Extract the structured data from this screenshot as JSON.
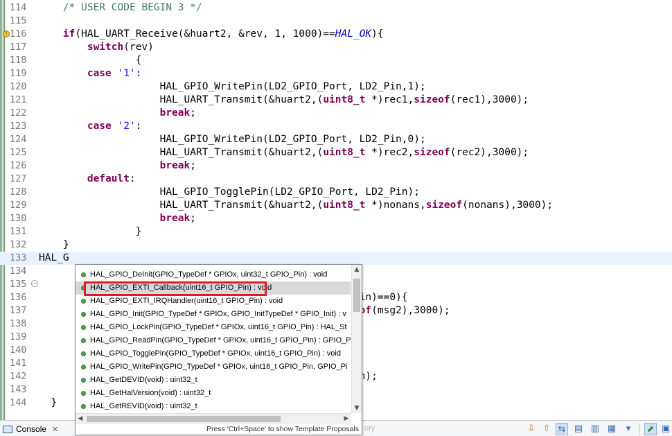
{
  "editor": {
    "lines": [
      {
        "n": "114",
        "segs": [
          {
            "t": "    ",
            "c": ""
          },
          {
            "t": "/* USER CODE BEGIN 3 */",
            "c": "cm"
          }
        ]
      },
      {
        "n": "115",
        "segs": []
      },
      {
        "n": "116",
        "marker": "warning",
        "segs": [
          {
            "t": "    ",
            "c": ""
          },
          {
            "t": "if",
            "c": "kw"
          },
          {
            "t": "(HAL_UART_Receive(&huart2, &rev, 1, 1000)==",
            "c": ""
          },
          {
            "t": "HAL_OK",
            "c": "it"
          },
          {
            "t": "){",
            "c": ""
          }
        ]
      },
      {
        "n": "117",
        "segs": [
          {
            "t": "        ",
            "c": ""
          },
          {
            "t": "switch",
            "c": "kw"
          },
          {
            "t": "(rev)",
            "c": ""
          }
        ]
      },
      {
        "n": "118",
        "segs": [
          {
            "t": "                {",
            "c": ""
          }
        ]
      },
      {
        "n": "119",
        "segs": [
          {
            "t": "        ",
            "c": ""
          },
          {
            "t": "case",
            "c": "kw"
          },
          {
            "t": " ",
            "c": ""
          },
          {
            "t": "'1'",
            "c": "str"
          },
          {
            "t": ":",
            "c": ""
          }
        ]
      },
      {
        "n": "120",
        "segs": [
          {
            "t": "                    HAL_GPIO_WritePin(LD2_GPIO_Port, LD2_Pin,1);",
            "c": ""
          }
        ]
      },
      {
        "n": "121",
        "segs": [
          {
            "t": "                    HAL_UART_Transmit(&huart2,(",
            "c": ""
          },
          {
            "t": "uint8_t",
            "c": "kw"
          },
          {
            "t": " *)rec1,",
            "c": ""
          },
          {
            "t": "sizeof",
            "c": "kw"
          },
          {
            "t": "(rec1),3000);",
            "c": ""
          }
        ]
      },
      {
        "n": "122",
        "segs": [
          {
            "t": "                    ",
            "c": ""
          },
          {
            "t": "break",
            "c": "kw"
          },
          {
            "t": ";",
            "c": ""
          }
        ]
      },
      {
        "n": "123",
        "segs": [
          {
            "t": "        ",
            "c": ""
          },
          {
            "t": "case",
            "c": "kw"
          },
          {
            "t": " ",
            "c": ""
          },
          {
            "t": "'2'",
            "c": "str"
          },
          {
            "t": ":",
            "c": ""
          }
        ]
      },
      {
        "n": "124",
        "segs": [
          {
            "t": "                    HAL_GPIO_WritePin(LD2_GPIO_Port, LD2_Pin,0);",
            "c": ""
          }
        ]
      },
      {
        "n": "125",
        "segs": [
          {
            "t": "                    HAL_UART_Transmit(&huart2,(",
            "c": ""
          },
          {
            "t": "uint8_t",
            "c": "kw"
          },
          {
            "t": " *)rec2,",
            "c": ""
          },
          {
            "t": "sizeof",
            "c": "kw"
          },
          {
            "t": "(rec2),3000);",
            "c": ""
          }
        ]
      },
      {
        "n": "126",
        "segs": [
          {
            "t": "                    ",
            "c": ""
          },
          {
            "t": "break",
            "c": "kw"
          },
          {
            "t": ";",
            "c": ""
          }
        ]
      },
      {
        "n": "127",
        "segs": [
          {
            "t": "        ",
            "c": ""
          },
          {
            "t": "default",
            "c": "kw"
          },
          {
            "t": ":",
            "c": ""
          }
        ]
      },
      {
        "n": "128",
        "segs": [
          {
            "t": "                    HAL_GPIO_TogglePin(LD2_GPIO_Port, LD2_Pin);",
            "c": ""
          }
        ]
      },
      {
        "n": "129",
        "segs": [
          {
            "t": "                    HAL_UART_Transmit(&huart2,(",
            "c": ""
          },
          {
            "t": "uint8_t",
            "c": "kw"
          },
          {
            "t": " *)nonans,",
            "c": ""
          },
          {
            "t": "sizeof",
            "c": "kw"
          },
          {
            "t": "(nonans),3000);",
            "c": ""
          }
        ]
      },
      {
        "n": "130",
        "segs": [
          {
            "t": "                    ",
            "c": ""
          },
          {
            "t": "break",
            "c": "kw"
          },
          {
            "t": ";",
            "c": ""
          }
        ]
      },
      {
        "n": "131",
        "segs": [
          {
            "t": "                }",
            "c": ""
          }
        ]
      },
      {
        "n": "132",
        "segs": [
          {
            "t": "    }",
            "c": ""
          }
        ]
      },
      {
        "n": "133",
        "current": true,
        "segs": [
          {
            "t": "HAL_G",
            "c": ""
          }
        ]
      },
      {
        "n": "134",
        "segs": []
      },
      {
        "n": "135",
        "fold": true,
        "segs": [
          {
            "t": "                                                    ",
            "c": ""
          },
          {
            "t": "",
            "c": ""
          }
        ]
      },
      {
        "n": "136",
        "segs": [
          {
            "t": "                                                 B1_Pin)==0){",
            "c": ""
          }
        ]
      },
      {
        "n": "137",
        "segs": [
          {
            "t": "                                                ,",
            "c": ""
          },
          {
            "t": "sizeof",
            "c": "kw"
          },
          {
            "t": "(msg2),3000);",
            "c": ""
          }
        ]
      },
      {
        "n": "138",
        "segs": [
          {
            "t": "                                                );",
            "c": ""
          }
        ]
      },
      {
        "n": "139",
        "segs": []
      },
      {
        "n": "140",
        "segs": []
      },
      {
        "n": "141",
        "segs": []
      },
      {
        "n": "142",
        "segs": [
          {
            "t": "                                                D2_Pin);",
            "c": ""
          }
        ]
      },
      {
        "n": "143",
        "segs": [
          {
            "t": "                                                in);",
            "c": ""
          }
        ]
      },
      {
        "n": "144",
        "segs": [
          {
            "t": "  }",
            "c": ""
          }
        ]
      }
    ]
  },
  "autocomplete": {
    "items": [
      "HAL_GPIO_DeInit(GPIO_TypeDef * GPIOx, uint32_t GPIO_Pin) : void",
      "HAL_GPIO_EXTI_Callback(uint16_t GPIO_Pin) : void",
      "HAL_GPIO_EXTI_IRQHandler(uint16_t GPIO_Pin) : void",
      "HAL_GPIO_Init(GPIO_TypeDef * GPIOx, GPIO_InitTypeDef * GPIO_Init) : v",
      "HAL_GPIO_LockPin(GPIO_TypeDef * GPIOx, uint16_t GPIO_Pin) : HAL_St",
      "HAL_GPIO_ReadPin(GPIO_TypeDef * GPIOx, uint16_t GPIO_Pin) : GPIO_P",
      "HAL_GPIO_TogglePin(GPIO_TypeDef * GPIOx, uint16_t GPIO_Pin) : void",
      "HAL_GPIO_WritePin(GPIO_TypeDef * GPIOx, uint16_t GPIO_Pin, GPIO_Pi",
      "HAL_GetDEVID(void) : uint32_t",
      "HAL_GetHalVersion(void) : uint32_t",
      "HAL_GetREVID(void) : uint32_t"
    ],
    "selected_index": 1,
    "hint": "Press 'Ctrl+Space' to show Template Proposals"
  },
  "statusbar": {
    "console_label": "Console",
    "faint_right": "ory"
  },
  "colors": {
    "keyword": "#7f0055",
    "comment": "#3f7f5f",
    "string": "#2a00ff",
    "highlight_border": "#e01b24",
    "current_line": "#e8f2fe"
  }
}
